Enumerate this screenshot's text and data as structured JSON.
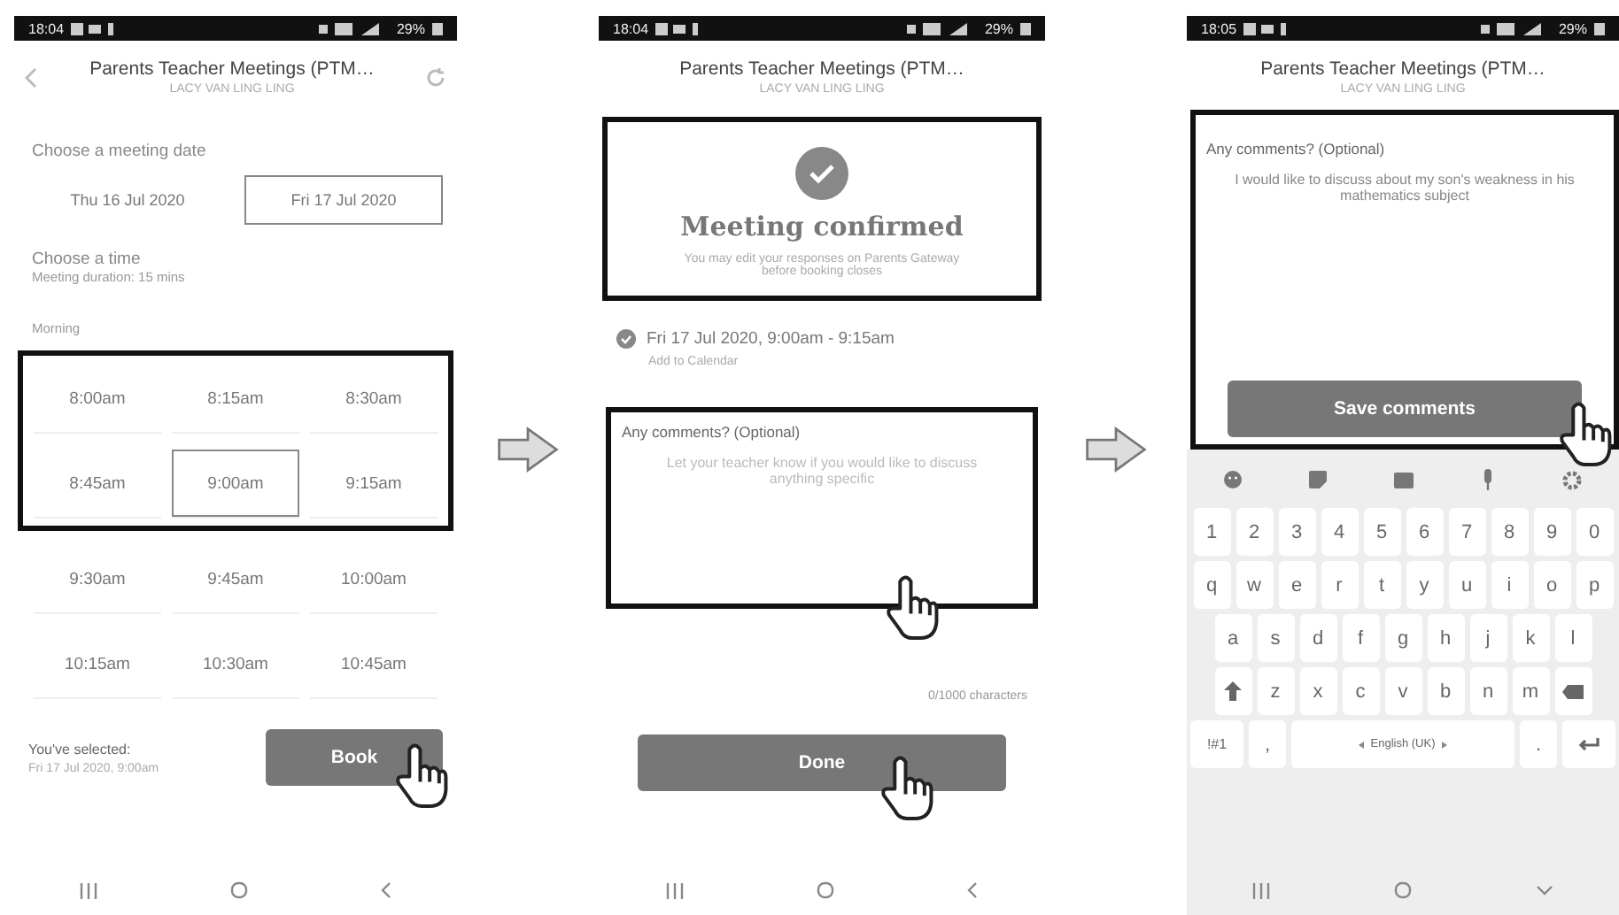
{
  "booking_screen": {
    "status_bar": {
      "time": "18:04",
      "battery": "29%"
    },
    "title": "Parents Teacher Meetings (PTM…",
    "subtitle": "LACY VAN LING LING",
    "date_prompt": "Choose a meeting date",
    "dates": [
      {
        "label": "Thu 16 Jul 2020",
        "selected": false
      },
      {
        "label": "Fri 17 Jul 2020",
        "selected": true
      }
    ],
    "time_prompt": "Choose a time",
    "duration": "Meeting duration: 15 mins",
    "period": "Morning",
    "time_rows": [
      {
        "highlighted": true,
        "slots": [
          {
            "label": "8:00am",
            "selected": false
          },
          {
            "label": "8:15am",
            "selected": false
          },
          {
            "label": "8:30am",
            "selected": false
          }
        ]
      },
      {
        "highlighted": true,
        "slots": [
          {
            "label": "8:45am",
            "selected": false
          },
          {
            "label": "9:00am",
            "selected": true
          },
          {
            "label": "9:15am",
            "selected": false
          }
        ]
      },
      {
        "highlighted": false,
        "slots": [
          {
            "label": "9:30am",
            "selected": false
          },
          {
            "label": "9:45am",
            "selected": false
          },
          {
            "label": "10:00am",
            "selected": false
          }
        ]
      },
      {
        "highlighted": false,
        "slots": [
          {
            "label": "10:15am",
            "selected": false
          },
          {
            "label": "10:30am",
            "selected": false
          },
          {
            "label": "10:45am",
            "selected": false
          }
        ]
      }
    ],
    "selection_label": "You've selected:",
    "selection_value": "Fri 17 Jul 2020, 9:00am",
    "book_button": {
      "label": "Book",
      "pointer": true
    }
  },
  "confirmation_screen": {
    "status_bar": {
      "time": "18:04",
      "battery": "29%"
    },
    "title": "Parents Teacher Meetings (PTM…",
    "subtitle": "LACY VAN LING LING",
    "card": {
      "highlighted": true,
      "heading": "Meeting confirmed",
      "message": "You may edit your responses on Parents Gateway before booking closes"
    },
    "booking": "Fri 17 Jul 2020, 9:00am - 9:15am",
    "calendar_link": "Add to Calendar",
    "comments": {
      "highlighted": true,
      "pointer": true,
      "label": "Any comments? (Optional)",
      "placeholder": "Let your teacher know if you would like to discuss anything specific"
    },
    "counter": "0/1000 characters",
    "done_button": {
      "label": "Done",
      "pointer": true
    }
  },
  "comments_screen": {
    "status_bar": {
      "time": "18:05",
      "battery": "29%"
    },
    "title": "Parents Teacher Meetings (PTM…",
    "subtitle": "LACY VAN LING LING",
    "comments": {
      "highlighted": true,
      "label": "Any comments? (Optional)",
      "value": "I would like to discuss about my son's weakness in his mathematics subject"
    },
    "save_button": {
      "label": "Save comments",
      "pointer": true
    },
    "keyboard": {
      "rows": [
        {
          "keys": [
            "1",
            "2",
            "3",
            "4",
            "5",
            "6",
            "7",
            "8",
            "9",
            "0"
          ]
        },
        {
          "keys": [
            "q",
            "w",
            "e",
            "r",
            "t",
            "y",
            "u",
            "i",
            "o",
            "p"
          ]
        },
        {
          "keys": [
            "a",
            "s",
            "d",
            "f",
            "g",
            "h",
            "j",
            "k",
            "l"
          ]
        },
        {
          "kind": "shift_row",
          "keys": [
            "z",
            "x",
            "c",
            "v",
            "b",
            "n",
            "m"
          ]
        }
      ],
      "symbols_key": "!#1",
      "comma_key": ",",
      "space_label": "English (UK)",
      "period_key": "."
    }
  }
}
